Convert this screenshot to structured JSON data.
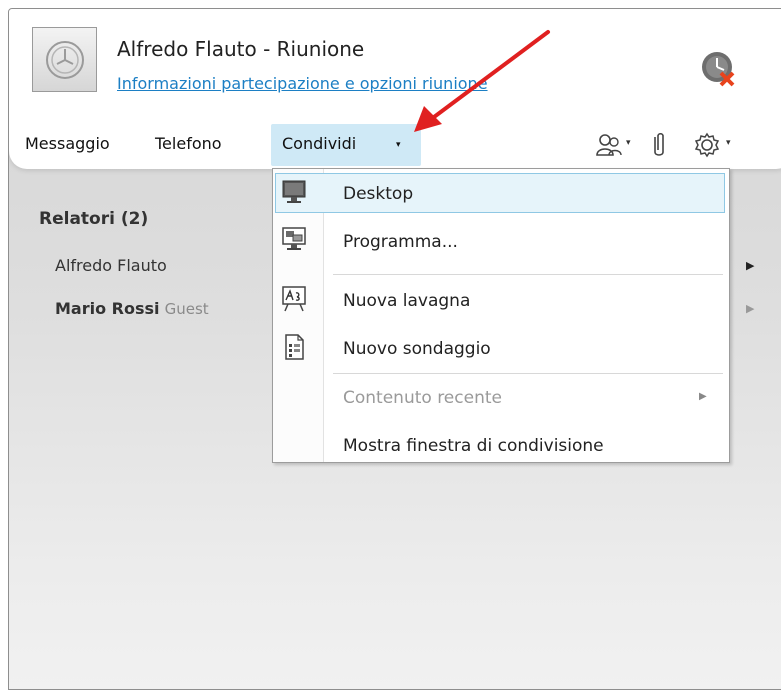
{
  "window": {
    "title": "Alfredo Flauto - Riunione",
    "subtitle_link": "Informazioni partecipazione e opzioni riunione"
  },
  "toolbar": {
    "message": "Messaggio",
    "phone": "Telefono",
    "share": "Condividi",
    "share_caret": "▾",
    "people_caret": "▾",
    "settings_caret": "▾"
  },
  "participants": {
    "section_title": "Relatori (2)",
    "speaker1": "Alfredo Flauto",
    "speaker2_name": "Mario Rossi",
    "speaker2_role": "Guest"
  },
  "share_menu": {
    "items": [
      {
        "label": "Desktop",
        "icon": "desktop-icon"
      },
      {
        "label": "Programma...",
        "icon": "program-icon"
      },
      {
        "label": "Nuova lavagna",
        "icon": "whiteboard-icon"
      },
      {
        "label": "Nuovo sondaggio",
        "icon": "poll-icon"
      },
      {
        "label": "Contenuto recente",
        "icon": "",
        "disabled": true
      },
      {
        "label": "Mostra finestra di condivisione",
        "icon": ""
      }
    ]
  },
  "colors": {
    "link": "#1c7fc4",
    "highlight_bg": "#e6f4fa",
    "highlight_border": "#8fc8e4",
    "share_bg": "#cfe9f6",
    "annotation_arrow": "#e02020"
  }
}
